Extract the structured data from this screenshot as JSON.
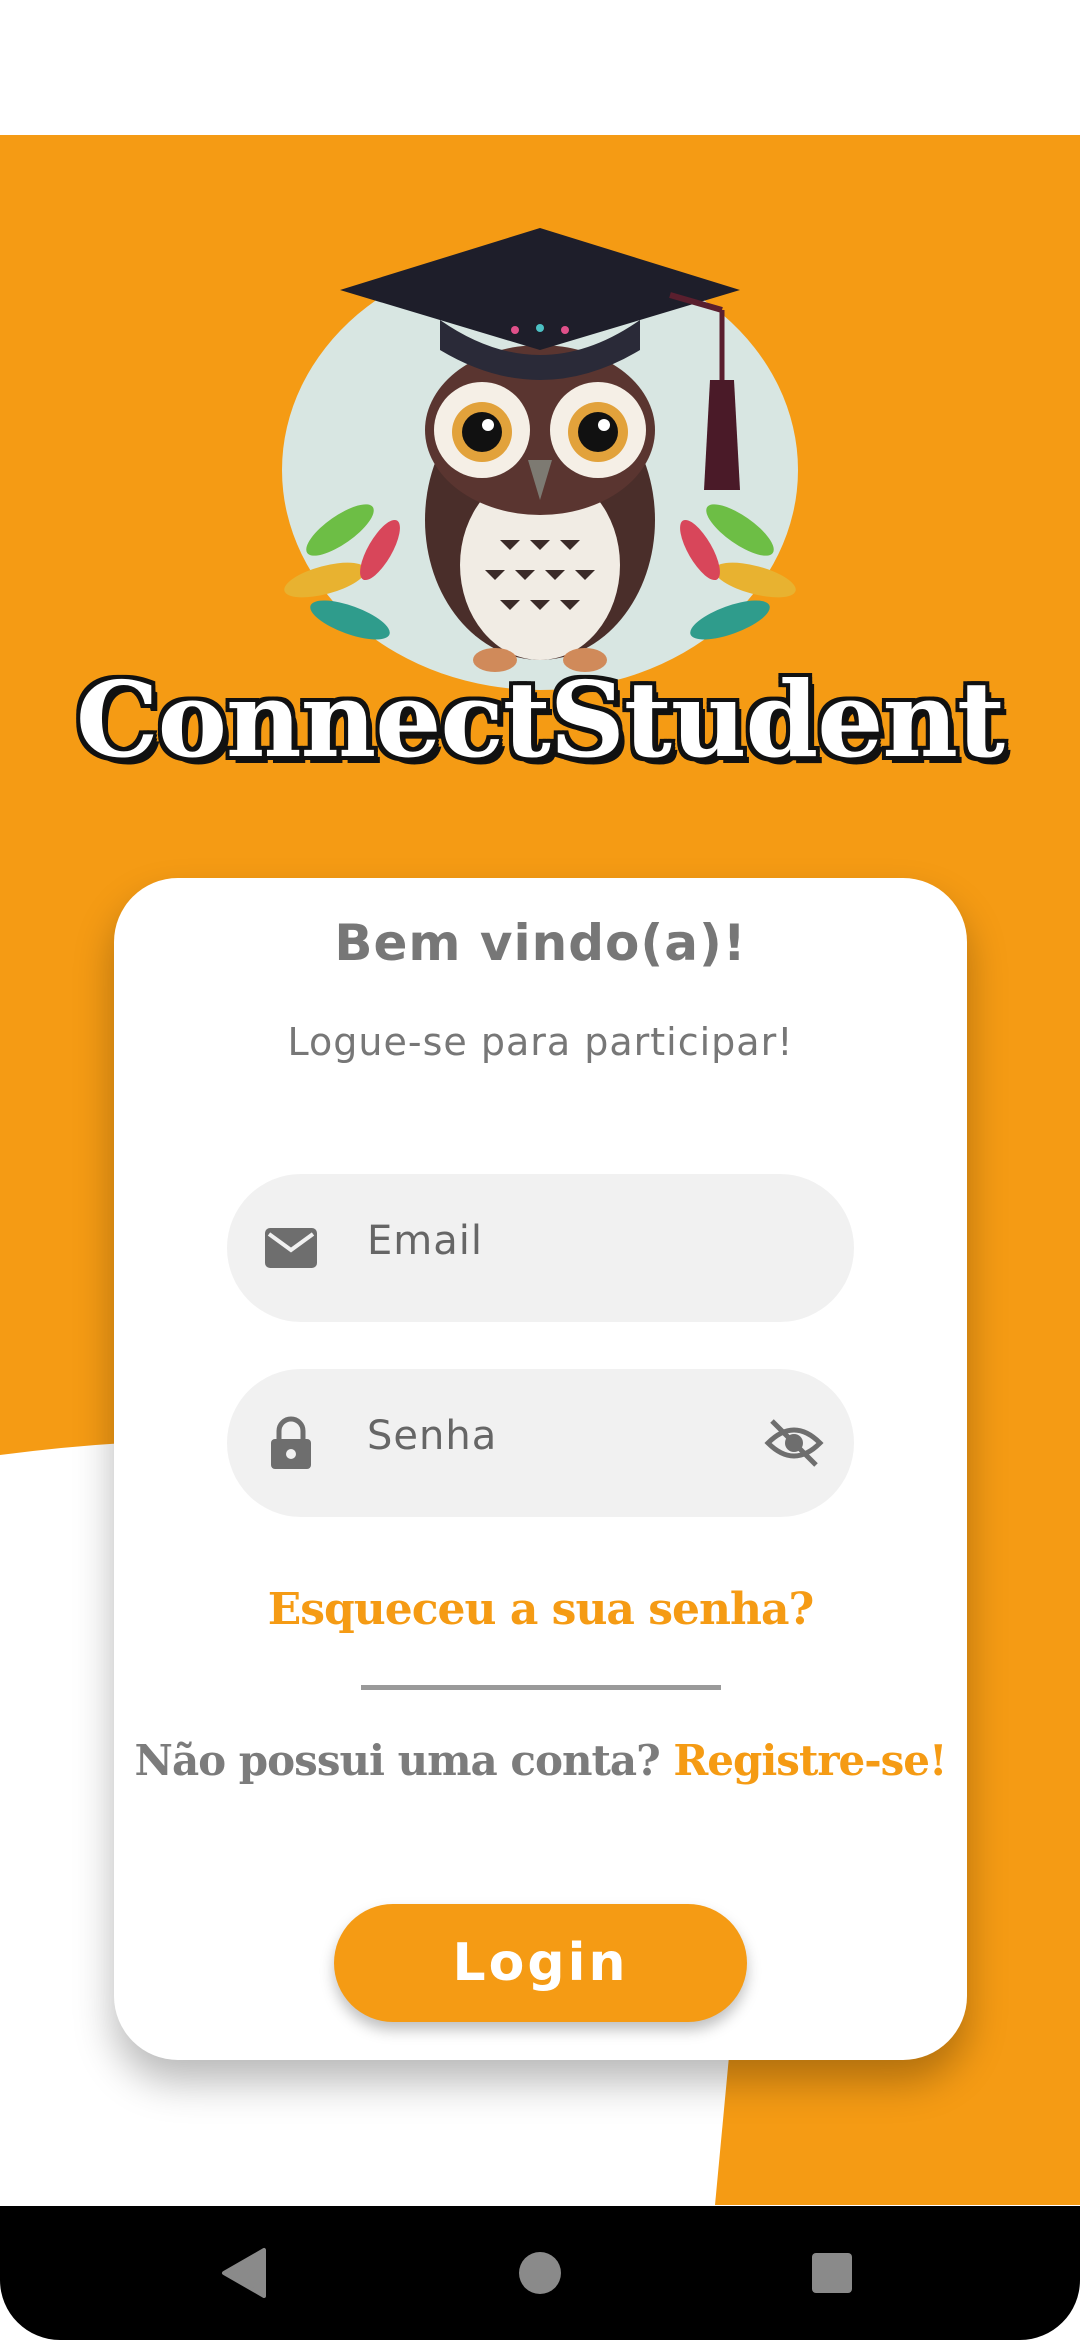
{
  "app": {
    "name": "ConnectStudent"
  },
  "logo": {
    "icon": "owl-graduation-cap-icon"
  },
  "login_card": {
    "welcome": "Bem vindo(a)!",
    "subtitle": "Logue-se para participar!",
    "email_field": {
      "placeholder": "Email",
      "icon": "mail-icon"
    },
    "password_field": {
      "placeholder": "Senha",
      "icon": "lock-icon",
      "toggle_icon": "eye-off-icon"
    },
    "forgot_password": "Esqueceu a sua senha?",
    "no_account_text": "Não possui uma conta?",
    "register_link": "Registre-se!",
    "login_button": "Login"
  },
  "nav": {
    "back": "back-icon",
    "home": "home-icon",
    "recents": "recents-icon"
  },
  "colors": {
    "accent": "#F59B14",
    "card": "#FFFFFF",
    "field": "#F1F1F1",
    "text_gray": "#777777"
  }
}
